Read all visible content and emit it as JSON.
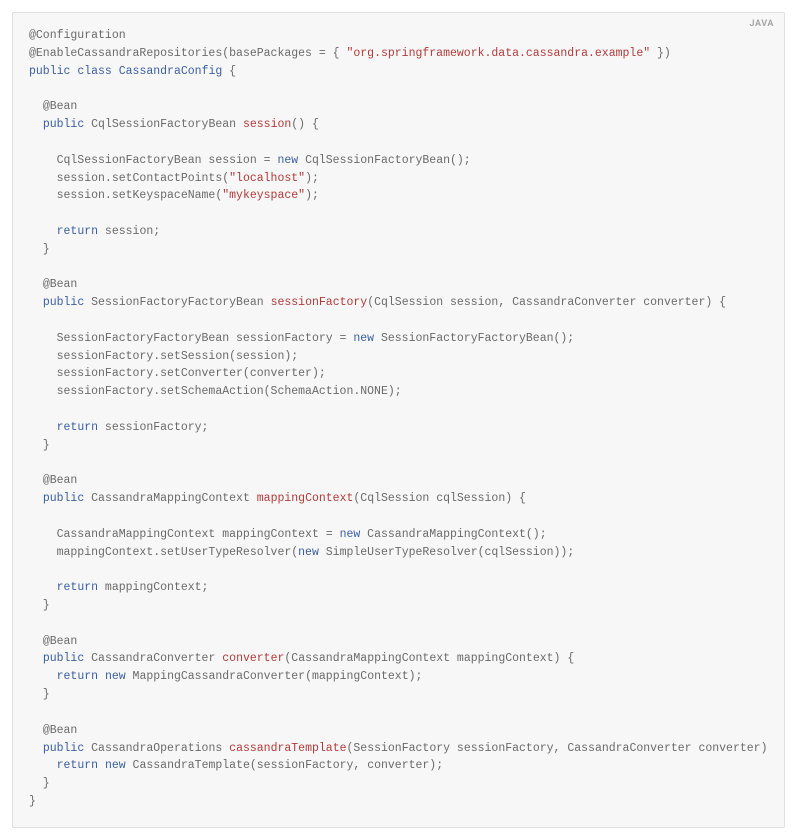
{
  "lang_label": "JAVA",
  "tokens": [
    {
      "cls": "tok-anno",
      "txt": "@Configuration"
    },
    {
      "cls": "nl"
    },
    {
      "cls": "tok-anno",
      "txt": "@EnableCassandraRepositories"
    },
    {
      "cls": "tok-plain",
      "txt": "(basePackages = { "
    },
    {
      "cls": "tok-string",
      "txt": "\"org.springframework.data.cassandra.example\""
    },
    {
      "cls": "tok-plain",
      "txt": " })"
    },
    {
      "cls": "nl"
    },
    {
      "cls": "tok-keyword",
      "txt": "public"
    },
    {
      "cls": "tok-plain",
      "txt": " "
    },
    {
      "cls": "tok-keyword",
      "txt": "class"
    },
    {
      "cls": "tok-plain",
      "txt": " "
    },
    {
      "cls": "tok-class",
      "txt": "CassandraConfig"
    },
    {
      "cls": "tok-plain",
      "txt": " {"
    },
    {
      "cls": "nl"
    },
    {
      "cls": "nl"
    },
    {
      "cls": "tok-plain",
      "txt": "  "
    },
    {
      "cls": "tok-anno",
      "txt": "@Bean"
    },
    {
      "cls": "nl"
    },
    {
      "cls": "tok-plain",
      "txt": "  "
    },
    {
      "cls": "tok-keyword",
      "txt": "public"
    },
    {
      "cls": "tok-plain",
      "txt": " CqlSessionFactoryBean "
    },
    {
      "cls": "tok-method",
      "txt": "session"
    },
    {
      "cls": "tok-plain",
      "txt": "() {"
    },
    {
      "cls": "nl"
    },
    {
      "cls": "nl"
    },
    {
      "cls": "tok-plain",
      "txt": "    CqlSessionFactoryBean session = "
    },
    {
      "cls": "tok-keyword",
      "txt": "new"
    },
    {
      "cls": "tok-plain",
      "txt": " CqlSessionFactoryBean();"
    },
    {
      "cls": "nl"
    },
    {
      "cls": "tok-plain",
      "txt": "    session.setContactPoints("
    },
    {
      "cls": "tok-string",
      "txt": "\"localhost\""
    },
    {
      "cls": "tok-plain",
      "txt": ");"
    },
    {
      "cls": "nl"
    },
    {
      "cls": "tok-plain",
      "txt": "    session.setKeyspaceName("
    },
    {
      "cls": "tok-string",
      "txt": "\"mykeyspace\""
    },
    {
      "cls": "tok-plain",
      "txt": ");"
    },
    {
      "cls": "nl"
    },
    {
      "cls": "nl"
    },
    {
      "cls": "tok-plain",
      "txt": "    "
    },
    {
      "cls": "tok-keyword",
      "txt": "return"
    },
    {
      "cls": "tok-plain",
      "txt": " session;"
    },
    {
      "cls": "nl"
    },
    {
      "cls": "tok-plain",
      "txt": "  }"
    },
    {
      "cls": "nl"
    },
    {
      "cls": "nl"
    },
    {
      "cls": "tok-plain",
      "txt": "  "
    },
    {
      "cls": "tok-anno",
      "txt": "@Bean"
    },
    {
      "cls": "nl"
    },
    {
      "cls": "tok-plain",
      "txt": "  "
    },
    {
      "cls": "tok-keyword",
      "txt": "public"
    },
    {
      "cls": "tok-plain",
      "txt": " SessionFactoryFactoryBean "
    },
    {
      "cls": "tok-method",
      "txt": "sessionFactory"
    },
    {
      "cls": "tok-plain",
      "txt": "(CqlSession session, CassandraConverter converter) {"
    },
    {
      "cls": "nl"
    },
    {
      "cls": "nl"
    },
    {
      "cls": "tok-plain",
      "txt": "    SessionFactoryFactoryBean sessionFactory = "
    },
    {
      "cls": "tok-keyword",
      "txt": "new"
    },
    {
      "cls": "tok-plain",
      "txt": " SessionFactoryFactoryBean();"
    },
    {
      "cls": "nl"
    },
    {
      "cls": "tok-plain",
      "txt": "    sessionFactory.setSession(session);"
    },
    {
      "cls": "nl"
    },
    {
      "cls": "tok-plain",
      "txt": "    sessionFactory.setConverter(converter);"
    },
    {
      "cls": "nl"
    },
    {
      "cls": "tok-plain",
      "txt": "    sessionFactory.setSchemaAction(SchemaAction.NONE);"
    },
    {
      "cls": "nl"
    },
    {
      "cls": "nl"
    },
    {
      "cls": "tok-plain",
      "txt": "    "
    },
    {
      "cls": "tok-keyword",
      "txt": "return"
    },
    {
      "cls": "tok-plain",
      "txt": " sessionFactory;"
    },
    {
      "cls": "nl"
    },
    {
      "cls": "tok-plain",
      "txt": "  }"
    },
    {
      "cls": "nl"
    },
    {
      "cls": "nl"
    },
    {
      "cls": "tok-plain",
      "txt": "  "
    },
    {
      "cls": "tok-anno",
      "txt": "@Bean"
    },
    {
      "cls": "nl"
    },
    {
      "cls": "tok-plain",
      "txt": "  "
    },
    {
      "cls": "tok-keyword",
      "txt": "public"
    },
    {
      "cls": "tok-plain",
      "txt": " CassandraMappingContext "
    },
    {
      "cls": "tok-method",
      "txt": "mappingContext"
    },
    {
      "cls": "tok-plain",
      "txt": "(CqlSession cqlSession) {"
    },
    {
      "cls": "nl"
    },
    {
      "cls": "nl"
    },
    {
      "cls": "tok-plain",
      "txt": "    CassandraMappingContext mappingContext = "
    },
    {
      "cls": "tok-keyword",
      "txt": "new"
    },
    {
      "cls": "tok-plain",
      "txt": " CassandraMappingContext();"
    },
    {
      "cls": "nl"
    },
    {
      "cls": "tok-plain",
      "txt": "    mappingContext.setUserTypeResolver("
    },
    {
      "cls": "tok-keyword",
      "txt": "new"
    },
    {
      "cls": "tok-plain",
      "txt": " SimpleUserTypeResolver(cqlSession));"
    },
    {
      "cls": "nl"
    },
    {
      "cls": "nl"
    },
    {
      "cls": "tok-plain",
      "txt": "    "
    },
    {
      "cls": "tok-keyword",
      "txt": "return"
    },
    {
      "cls": "tok-plain",
      "txt": " mappingContext;"
    },
    {
      "cls": "nl"
    },
    {
      "cls": "tok-plain",
      "txt": "  }"
    },
    {
      "cls": "nl"
    },
    {
      "cls": "nl"
    },
    {
      "cls": "tok-plain",
      "txt": "  "
    },
    {
      "cls": "tok-anno",
      "txt": "@Bean"
    },
    {
      "cls": "nl"
    },
    {
      "cls": "tok-plain",
      "txt": "  "
    },
    {
      "cls": "tok-keyword",
      "txt": "public"
    },
    {
      "cls": "tok-plain",
      "txt": " CassandraConverter "
    },
    {
      "cls": "tok-method",
      "txt": "converter"
    },
    {
      "cls": "tok-plain",
      "txt": "(CassandraMappingContext mappingContext) {"
    },
    {
      "cls": "nl"
    },
    {
      "cls": "tok-plain",
      "txt": "    "
    },
    {
      "cls": "tok-keyword",
      "txt": "return"
    },
    {
      "cls": "tok-plain",
      "txt": " "
    },
    {
      "cls": "tok-keyword",
      "txt": "new"
    },
    {
      "cls": "tok-plain",
      "txt": " MappingCassandraConverter(mappingContext);"
    },
    {
      "cls": "nl"
    },
    {
      "cls": "tok-plain",
      "txt": "  }"
    },
    {
      "cls": "nl"
    },
    {
      "cls": "nl"
    },
    {
      "cls": "tok-plain",
      "txt": "  "
    },
    {
      "cls": "tok-anno",
      "txt": "@Bean"
    },
    {
      "cls": "nl"
    },
    {
      "cls": "tok-plain",
      "txt": "  "
    },
    {
      "cls": "tok-keyword",
      "txt": "public"
    },
    {
      "cls": "tok-plain",
      "txt": " CassandraOperations "
    },
    {
      "cls": "tok-method",
      "txt": "cassandraTemplate"
    },
    {
      "cls": "tok-plain",
      "txt": "(SessionFactory sessionFactory, CassandraConverter converter) {"
    },
    {
      "cls": "nl"
    },
    {
      "cls": "tok-plain",
      "txt": "    "
    },
    {
      "cls": "tok-keyword",
      "txt": "return"
    },
    {
      "cls": "tok-plain",
      "txt": " "
    },
    {
      "cls": "tok-keyword",
      "txt": "new"
    },
    {
      "cls": "tok-plain",
      "txt": " CassandraTemplate(sessionFactory, converter);"
    },
    {
      "cls": "nl"
    },
    {
      "cls": "tok-plain",
      "txt": "  }"
    },
    {
      "cls": "nl"
    },
    {
      "cls": "tok-plain",
      "txt": "}"
    }
  ]
}
